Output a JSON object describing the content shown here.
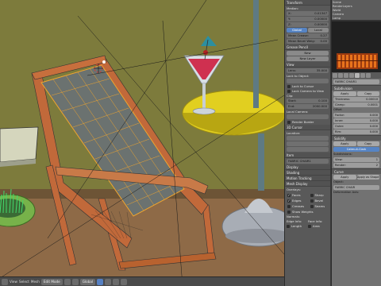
{
  "npanel": {
    "transform_header": "Transform",
    "median_label": "Median:",
    "median": [
      {
        "axis": "X:",
        "value": "0.01347"
      },
      {
        "axis": "Y:",
        "value": "0.00000"
      },
      {
        "axis": "Z:",
        "value": "0.00000"
      }
    ],
    "mode_buttons": [
      "Global",
      "Local"
    ],
    "mean_crease": {
      "label": "Mean Crease:",
      "value": "0.27"
    },
    "mean_bevel": {
      "label": "Mean Bevel Weig:",
      "value": "0.00"
    },
    "grease_pencil_header": "Grease Pencil",
    "new_button": "New",
    "new_layer_button": "New Layer",
    "view_header": "View",
    "lens": {
      "label": "Lens:",
      "value": "35.000"
    },
    "lock_to_object_label": "Lock to Object:",
    "lock_to_cursor": "Lock to Cursor",
    "lock_camera": "Lock Camera to View",
    "clip_label": "Clip:",
    "clip_start": {
      "label": "Start:",
      "value": "0.100"
    },
    "clip_end": {
      "label": "End:",
      "value": "2000.000"
    },
    "local_camera_label": "Local Camera:",
    "render_border": "Render Border",
    "cursor_header": "3D Cursor",
    "location_label": "Location:",
    "item_header": "Item",
    "item_name": "FABRIC CHAIR1",
    "display_header": "Display",
    "shading_header": "Shading",
    "motion_tracking": "Motion Tracking",
    "mesh_display_header": "Mesh Display",
    "overlays_label": "Overlays:",
    "overlay_checks": [
      {
        "label": "Faces",
        "on": true
      },
      {
        "label": "Sharp",
        "on": false
      },
      {
        "label": "Edges",
        "on": true
      },
      {
        "label": "Bevel",
        "on": false
      },
      {
        "label": "Creases",
        "on": false
      },
      {
        "label": "Seams",
        "on": false
      }
    ],
    "show_weights": "Show Weights",
    "normals_label": "Normals:",
    "edge_info_label": "Edge Info:",
    "face_info_label": "Face Info:",
    "length_label": "Length",
    "area_label": "Area"
  },
  "props": {
    "outliner": [
      "Scene",
      "RenderLayers",
      "World",
      "Camera",
      "Lamp"
    ],
    "object_name": "FABRIC CHAIR1",
    "subdivision_header": "Subdivision",
    "apply_label": "Apply",
    "catmull": "Catmull-Clark",
    "simple": "Simple",
    "subdivisions_label": "Subdivisions:",
    "view_levels": {
      "label": "View:",
      "value": "1"
    },
    "render_levels": {
      "label": "Render:",
      "value": "2"
    },
    "bevel": [
      {
        "label": "Thickness:",
        "value": "0.00010"
      },
      {
        "label": "Clamp:",
        "value": "0.0001"
      }
    ],
    "offset_label": "Offset",
    "factor": {
      "label": "Factor:",
      "value": "0.000"
    },
    "inner": {
      "label": "Inner:",
      "value": "0.000"
    },
    "outer": {
      "label": "Outer:",
      "value": "0.000"
    },
    "rim": {
      "label": "Rim:",
      "value": "0.000"
    },
    "solidify_header": "Solidify",
    "copy_label": "Copy",
    "curve_header": "Curve",
    "apply_as_shape": "Apply as Shape",
    "object_label": "Object:",
    "deform_axis": "Deformation Axis:",
    "object_value": "FABRIC CHAIR"
  },
  "viewport": {
    "colors": {
      "wall": "#7d7b3c",
      "floor": "#8e6a47",
      "chair_wood": "#c1693a",
      "fabric": "#6b7270",
      "wire": "#f0a52e",
      "table_top": "#e1cf20",
      "pole": "#5e7a83",
      "base": "#a8adb5",
      "glass_liquid": "#cf3050"
    }
  },
  "header": {
    "view_menu": "View",
    "select_menu": "Select",
    "mesh_menu": "Mesh",
    "mode": "Edit Mode",
    "pivot": "Global"
  }
}
